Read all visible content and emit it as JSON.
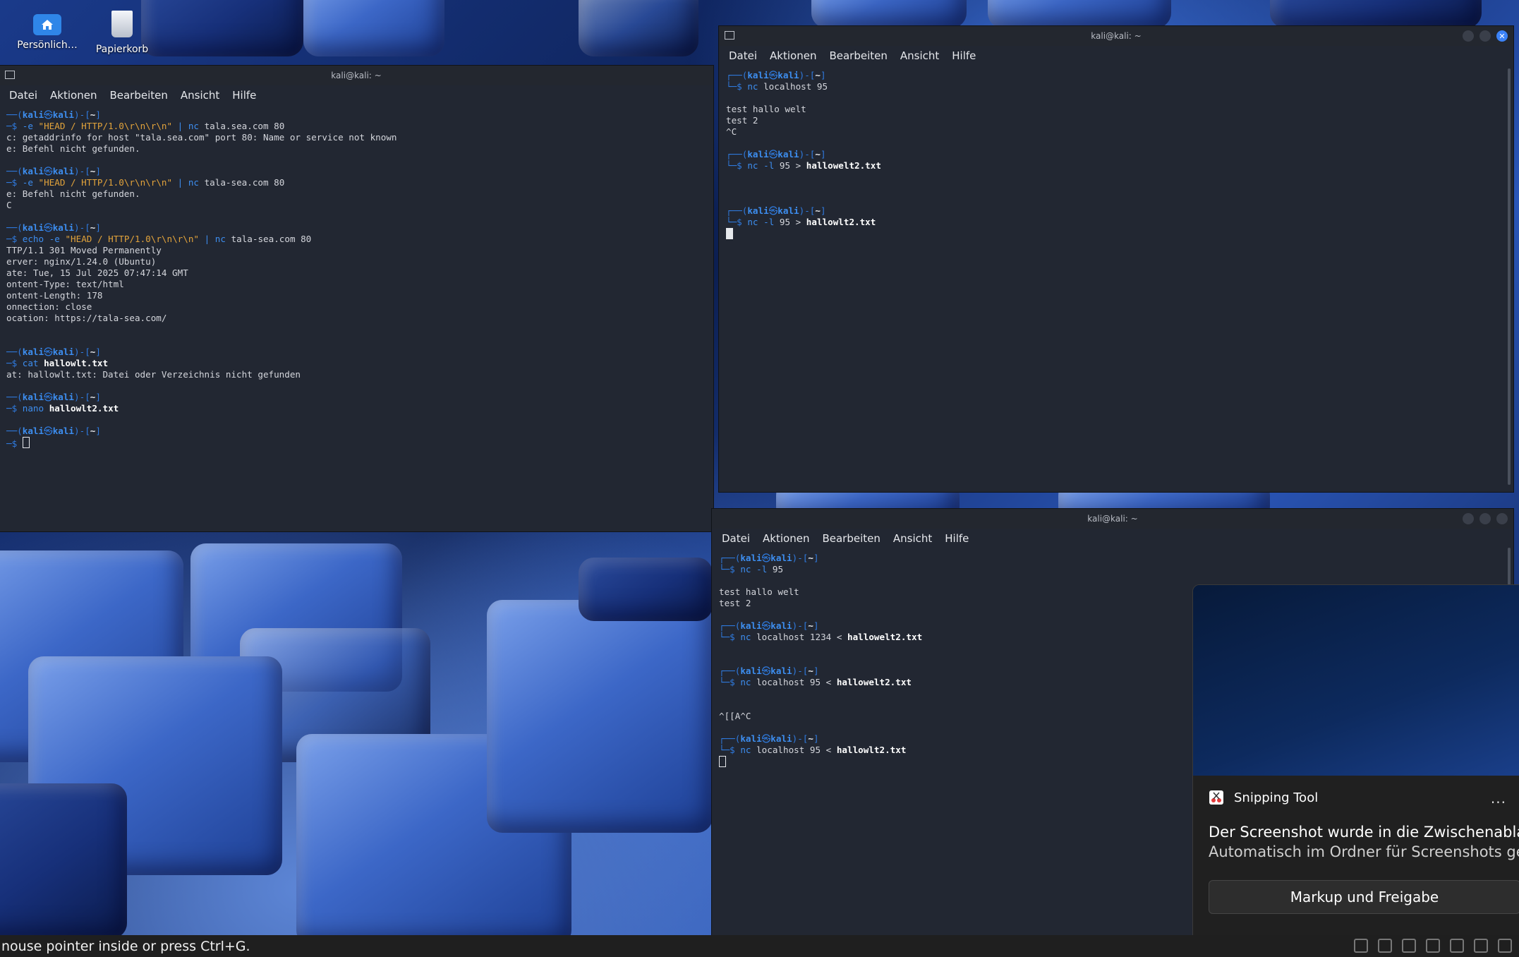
{
  "desktop": {
    "icons": [
      {
        "label": "Persönlich…"
      },
      {
        "label": "Papierkorb"
      }
    ]
  },
  "menu_labels": [
    "Datei",
    "Aktionen",
    "Bearbeiten",
    "Ansicht",
    "Hilfe"
  ],
  "prompt": {
    "user": "kali",
    "at": "㉿",
    "host": "kali",
    "dir": "~"
  },
  "terminals": {
    "left": {
      "title": "kali@kali: ~",
      "lines": [
        "──(kali㉿kali)-[~]",
        "─$ -e \"HEAD / HTTP/1.0\\r\\n\\r\\n\" | nc tala.sea.com 80",
        "c: getaddrinfo for host \"tala.sea.com\" port 80: Name or service not known",
        "e: Befehl nicht gefunden.",
        "",
        "──(kali㉿kali)-[~]",
        "─$ -e \"HEAD / HTTP/1.0\\r\\n\\r\\n\" | nc tala-sea.com 80",
        "e: Befehl nicht gefunden.",
        "C",
        "",
        "──(kali㉿kali)-[~]",
        "─$ echo -e \"HEAD / HTTP/1.0\\r\\n\\r\\n\" | nc tala-sea.com 80",
        "TTP/1.1 301 Moved Permanently",
        "erver: nginx/1.24.0 (Ubuntu)",
        "ate: Tue, 15 Jul 2025 07:47:14 GMT",
        "ontent-Type: text/html",
        "ontent-Length: 178",
        "onnection: close",
        "ocation: https://tala-sea.com/",
        "",
        "",
        "──(kali㉿kali)-[~]",
        "─$ cat hallowlt.txt",
        "at: hallowlt.txt: Datei oder Verzeichnis nicht gefunden",
        "",
        "──(kali㉿kali)-[~]",
        "─$ nano hallowlt2.txt",
        "",
        "──(kali㉿kali)-[~]",
        "─$ "
      ]
    },
    "top_right": {
      "title": "kali@kali: ~",
      "lines": [
        "┌──(kali㉿kali)-[~]",
        "└─$ nc localhost 95",
        "",
        "test hallo welt",
        "test 2",
        "^C",
        "",
        "┌──(kali㉿kali)-[~]",
        "└─$ nc -l 95 > hallowelt2.txt",
        "",
        "",
        "",
        "┌──(kali㉿kali)-[~]",
        "└─$ nc -l 95 > hallowlt2.txt",
        ""
      ]
    },
    "bottom_right": {
      "title": "kali@kali: ~",
      "lines": [
        "┌──(kali㉿kali)-[~]",
        "└─$ nc -l 95",
        "",
        "test hallo welt",
        "test 2",
        "",
        "┌──(kali㉿kali)-[~]",
        "└─$ nc localhost 1234 < hallowelt2.txt",
        "",
        "",
        "┌──(kali㉿kali)-[~]",
        "└─$ nc localhost 95 < hallowelt2.txt",
        "",
        "",
        "^[[A^C",
        "",
        "┌──(kali㉿kali)-[~]",
        "└─$ nc localhost 95 < hallowlt2.txt",
        ""
      ]
    }
  },
  "toast": {
    "app_name": "Snipping Tool",
    "more_label": "···",
    "message_line1": "Der Screenshot wurde in die Zwischenablage ko",
    "message_line2": "Automatisch im Ordner für Screenshots gespeic",
    "action_label": "Markup und Freigabe"
  },
  "statusbar": {
    "text": "nouse pointer inside or press Ctrl+G."
  },
  "colors": {
    "prompt_blue": "#3d8ef0",
    "string_orange": "#e2a33b",
    "terminal_bg": "#222732"
  }
}
